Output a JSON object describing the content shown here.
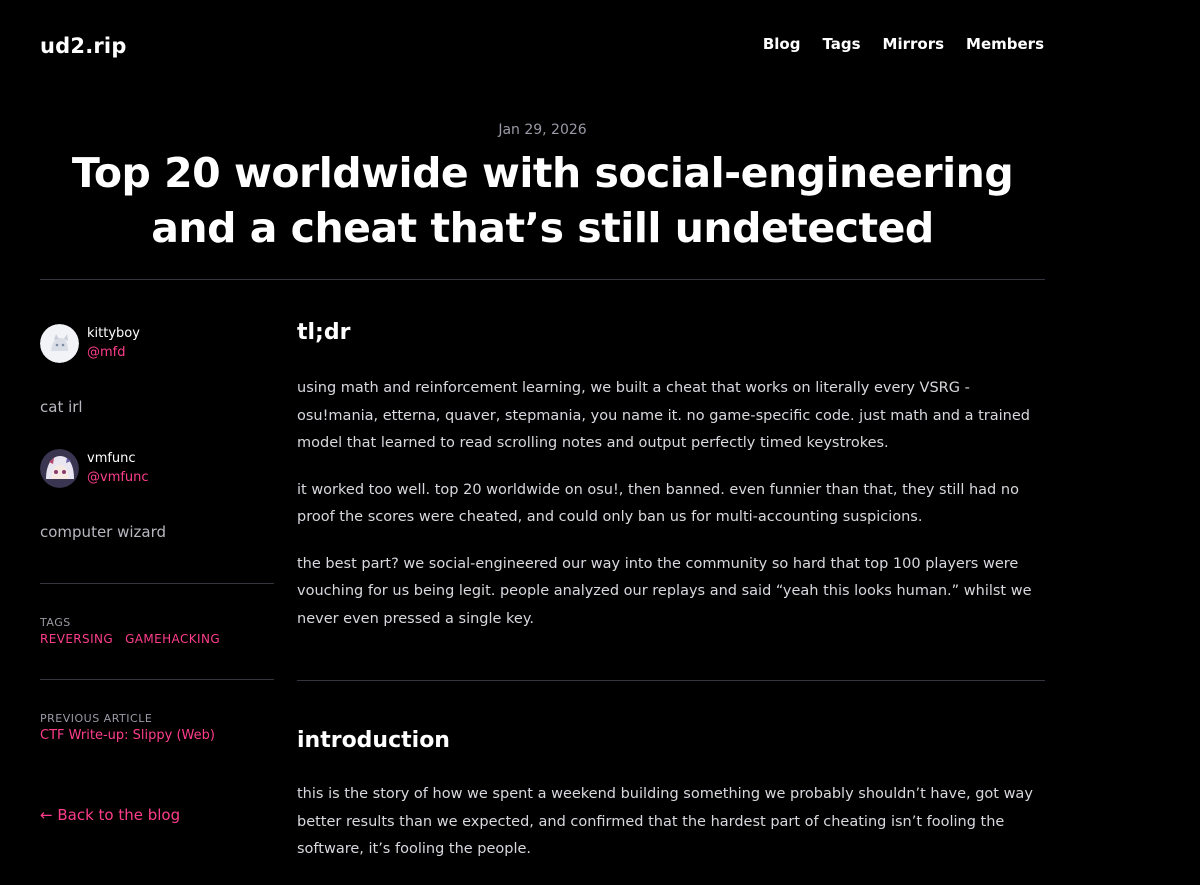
{
  "header": {
    "site_title": "ud2.rip",
    "nav": [
      "Blog",
      "Tags",
      "Mirrors",
      "Members"
    ]
  },
  "article": {
    "date": "Jan 29, 2026",
    "title": "Top 20 worldwide with social-engineering and a cheat that’s still undetected"
  },
  "sidebar": {
    "authors": [
      {
        "name": "kittyboy",
        "handle": "@mfd",
        "bio": "cat irl"
      },
      {
        "name": "vmfunc",
        "handle": "@vmfunc",
        "bio": "computer wizard"
      }
    ],
    "tags_label": "TAGS",
    "tags": [
      "REVERSING",
      "GAMEHACKING"
    ],
    "previous_label": "PREVIOUS ARTICLE",
    "previous_title": "CTF Write-up: Slippy (Web)",
    "back_link": "← Back to the blog"
  },
  "content": {
    "sections": [
      {
        "heading": "tl;dr",
        "paragraphs": [
          "using math and reinforcement learning, we built a cheat that works on literally every VSRG - osu!mania, etterna, quaver, stepmania, you name it. no game-specific code. just math and a trained model that learned to read scrolling notes and output perfectly timed keystrokes.",
          "it worked too well. top 20 worldwide on osu!, then banned. even funnier than that, they still had no proof the scores were cheated, and could only ban us for multi-accounting suspicions.",
          "the best part? we social-engineered our way into the community so hard that top 100 players were vouching for us being legit. people analyzed our replays and said “yeah this looks human.” whilst we never even pressed a single key."
        ]
      },
      {
        "heading": "introduction",
        "paragraphs": [
          "this is the story of how we spent a weekend building something we probably shouldn’t have, got way better results than we expected, and confirmed that the hardest part of cheating isn’t fooling the software, it’s fooling the people."
        ]
      }
    ]
  },
  "colors": {
    "background": "#000000",
    "accent": "#ff3d8b",
    "divider": "#34353f",
    "muted": "#9a9aa6"
  }
}
